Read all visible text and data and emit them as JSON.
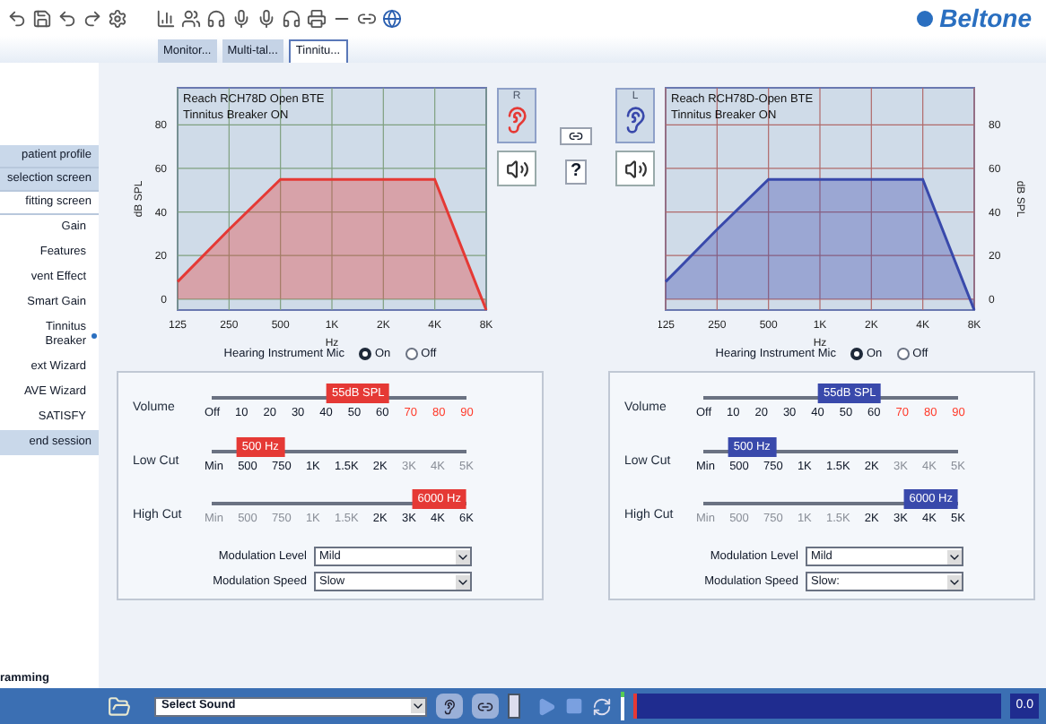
{
  "brand": "Beltone",
  "tabs": [
    {
      "label": "Monitor...",
      "selected": false
    },
    {
      "label": "Multi-tal...",
      "selected": false
    },
    {
      "label": "Tinnitu...",
      "selected": true
    }
  ],
  "sidebar": {
    "top": [
      {
        "label": "patient profile",
        "selected": false
      },
      {
        "label": "selection screen",
        "selected": false
      },
      {
        "label": "fitting screen",
        "selected": true
      }
    ],
    "steps": [
      {
        "label": "Gain",
        "selected": false
      },
      {
        "label": "Features",
        "selected": false
      },
      {
        "label": "vent Effect",
        "selected": false
      },
      {
        "label": "Smart Gain",
        "selected": false
      },
      {
        "label": "Tinnitus Breaker",
        "selected": true
      },
      {
        "label": "ext Wizard",
        "selected": false
      },
      {
        "label": "AVE Wizard",
        "selected": false
      },
      {
        "label": "SATISFY",
        "selected": false
      }
    ],
    "bottom": [
      {
        "label": "end session",
        "selected": false
      }
    ],
    "footer": "ramming"
  },
  "middle": {
    "help": "?"
  },
  "sides": [
    {
      "side": "R",
      "color": "#e53935",
      "chart_data": {
        "type": "area",
        "grid": true,
        "title": "Reach RCH78D Open BTE",
        "subtitle": "Tinnitus Breaker ON",
        "xlabel": "Hz",
        "ylabel": "dB SPL",
        "categories": [
          "125",
          "250",
          "500",
          "1K",
          "2K",
          "4K",
          "8K"
        ],
        "values": [
          8,
          32,
          55,
          55,
          55,
          55,
          -5
        ],
        "ylim": [
          -5,
          97
        ],
        "yticks": [
          0,
          20,
          40,
          60,
          80
        ]
      },
      "mic": {
        "label": "Hearing Instrument Mic",
        "options": [
          {
            "label": "On",
            "selected": true
          },
          {
            "label": "Off",
            "selected": false
          }
        ]
      },
      "sliders": [
        {
          "label": "Volume",
          "bubble": "55dB SPL",
          "level": 0.6,
          "ticks": [
            {
              "label": "Off",
              "kind": "normal"
            },
            {
              "label": "10",
              "kind": "normal"
            },
            {
              "label": "20",
              "kind": "normal"
            },
            {
              "label": "30",
              "kind": "normal"
            },
            {
              "label": "40",
              "kind": "normal"
            },
            {
              "label": "50",
              "kind": "normal"
            },
            {
              "label": "60",
              "kind": "normal"
            },
            {
              "label": "70",
              "kind": "loud"
            },
            {
              "label": "80",
              "kind": "loud"
            },
            {
              "label": "90",
              "kind": "loud"
            }
          ]
        },
        {
          "label": "Low Cut",
          "bubble": "500 Hz",
          "level": 0.12,
          "ticks": [
            {
              "label": "Min",
              "kind": "normal"
            },
            {
              "label": "500",
              "kind": "normal"
            },
            {
              "label": "750",
              "kind": "normal"
            },
            {
              "label": "1K",
              "kind": "normal"
            },
            {
              "label": "1.5K",
              "kind": "normal"
            },
            {
              "label": "2K",
              "kind": "normal"
            },
            {
              "label": "3K",
              "kind": "disabled"
            },
            {
              "label": "4K",
              "kind": "disabled"
            },
            {
              "label": "5K",
              "kind": "disabled"
            }
          ]
        },
        {
          "label": "High Cut",
          "bubble": "6000 Hz",
          "level": 1,
          "ticks": [
            {
              "label": "Min",
              "kind": "disabled"
            },
            {
              "label": "500",
              "kind": "disabled"
            },
            {
              "label": "750",
              "kind": "disabled"
            },
            {
              "label": "1K",
              "kind": "disabled"
            },
            {
              "label": "1.5K",
              "kind": "disabled"
            },
            {
              "label": "2K",
              "kind": "normal"
            },
            {
              "label": "3K",
              "kind": "normal"
            },
            {
              "label": "4K",
              "kind": "normal"
            },
            {
              "label": "6K",
              "kind": "normal"
            }
          ]
        }
      ],
      "selects": [
        {
          "label": "Modulation Level",
          "value": "Mild"
        },
        {
          "label": "Modulation Speed",
          "value": "Slow"
        }
      ]
    },
    {
      "side": "L",
      "color": "#3949ab",
      "chart_data": {
        "type": "area",
        "grid": true,
        "title": "Reach RCH78D-Open BTE",
        "subtitle": "Tinnitus Breaker ON",
        "xlabel": "Hz",
        "ylabel": "dB SPL",
        "categories": [
          "125",
          "250",
          "500",
          "1K",
          "2K",
          "4K",
          "8K"
        ],
        "values": [
          8,
          32,
          55,
          55,
          55,
          55,
          -5
        ],
        "ylim": [
          -5,
          97
        ],
        "yticks": [
          0,
          20,
          40,
          60,
          80
        ]
      },
      "mic": {
        "label": "Hearing Instrument Mic",
        "options": [
          {
            "label": "On",
            "selected": true
          },
          {
            "label": "Off",
            "selected": false
          }
        ]
      },
      "sliders": [
        {
          "label": "Volume",
          "bubble": "55dB SPL",
          "level": 0.6,
          "ticks": [
            {
              "label": "Off",
              "kind": "normal"
            },
            {
              "label": "10",
              "kind": "normal"
            },
            {
              "label": "20",
              "kind": "normal"
            },
            {
              "label": "30",
              "kind": "normal"
            },
            {
              "label": "40",
              "kind": "normal"
            },
            {
              "label": "50",
              "kind": "normal"
            },
            {
              "label": "60",
              "kind": "normal"
            },
            {
              "label": "70",
              "kind": "loud"
            },
            {
              "label": "80",
              "kind": "loud"
            },
            {
              "label": "90",
              "kind": "loud"
            }
          ]
        },
        {
          "label": "Low Cut",
          "bubble": "500 Hz",
          "level": 0.12,
          "ticks": [
            {
              "label": "Min",
              "kind": "normal"
            },
            {
              "label": "500",
              "kind": "normal"
            },
            {
              "label": "750",
              "kind": "normal"
            },
            {
              "label": "1K",
              "kind": "normal"
            },
            {
              "label": "1.5K",
              "kind": "normal"
            },
            {
              "label": "2K",
              "kind": "normal"
            },
            {
              "label": "3K",
              "kind": "disabled"
            },
            {
              "label": "4K",
              "kind": "disabled"
            },
            {
              "label": "5K",
              "kind": "disabled"
            }
          ]
        },
        {
          "label": "High Cut",
          "bubble": "6000 Hz",
          "level": 1,
          "ticks": [
            {
              "label": "Min",
              "kind": "disabled"
            },
            {
              "label": "500",
              "kind": "disabled"
            },
            {
              "label": "750",
              "kind": "disabled"
            },
            {
              "label": "1K",
              "kind": "disabled"
            },
            {
              "label": "1.5K",
              "kind": "disabled"
            },
            {
              "label": "2K",
              "kind": "normal"
            },
            {
              "label": "3K",
              "kind": "normal"
            },
            {
              "label": "4K",
              "kind": "normal"
            },
            {
              "label": "5K",
              "kind": "normal"
            }
          ]
        }
      ],
      "selects": [
        {
          "label": "Modulation Level",
          "value": "Mild"
        },
        {
          "label": "Modulation Speed",
          "value": "Slow:"
        }
      ]
    }
  ],
  "player": {
    "sound": "Select Sound",
    "time": "0.0"
  }
}
